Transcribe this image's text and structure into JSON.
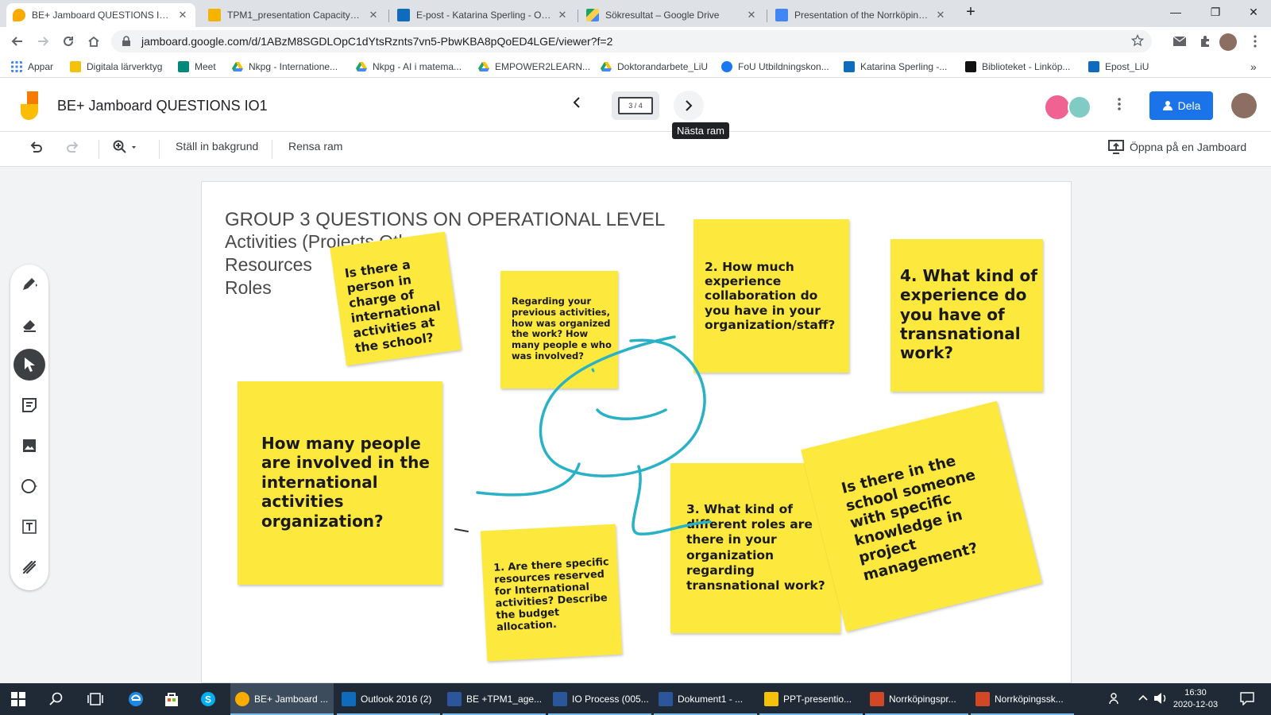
{
  "browser": {
    "tabs": [
      {
        "title": "BE+ Jamboard QUESTIONS IO1 -",
        "active": true,
        "favicon_color": "#f9ab00"
      },
      {
        "title": "TPM1_presentation Capacity Buil",
        "active": false,
        "favicon_color": "#f4b400"
      },
      {
        "title": "E-post - Katarina Sperling - Outlo",
        "active": false,
        "favicon_color": "#0f6cbd"
      },
      {
        "title": "Sökresultat – Google Drive",
        "active": false,
        "favicon_color": "#1fa463"
      },
      {
        "title": "Presentation of the Norrköping n",
        "active": false,
        "favicon_color": "#4285f4"
      }
    ],
    "close_glyph": "✕",
    "new_tab_glyph": "+",
    "window_controls": {
      "minimize": "—",
      "restore": "❐",
      "close": "✕"
    },
    "url": "jamboard.google.com/d/1ABzM8SGDLOpC1dYtsRznts7vn5-PbwKBA8pQoED4LGE/viewer?f=2",
    "bookmarks": [
      {
        "label": "Appar",
        "icon": "apps-grid-icon",
        "color": "#4285f4"
      },
      {
        "label": "Digitala lärverktyg",
        "icon": "folder-icon",
        "color": "#f4c20d"
      },
      {
        "label": "Meet",
        "icon": "meet-icon",
        "color": "#00897b"
      },
      {
        "label": "Nkpg - Internatione...",
        "icon": "drive-icon",
        "color": "#1fa463"
      },
      {
        "label": "Nkpg - AI i matema...",
        "icon": "drive-icon",
        "color": "#1fa463"
      },
      {
        "label": "EMPOWER2LEARN...",
        "icon": "drive-icon",
        "color": "#1fa463"
      },
      {
        "label": "Doktorandarbete_LiU",
        "icon": "drive-icon",
        "color": "#1fa463"
      },
      {
        "label": "FoU Utbildningskon...",
        "icon": "facebook-icon",
        "color": "#1877f2"
      },
      {
        "label": "Katarina Sperling -...",
        "icon": "outlook-icon",
        "color": "#0f6cbd"
      },
      {
        "label": "Biblioteket - Linköp...",
        "icon": "liu-icon",
        "color": "#111111"
      },
      {
        "label": "Epost_LiU",
        "icon": "outlook-icon",
        "color": "#0f6cbd"
      }
    ],
    "bookmarks_overflow": "»"
  },
  "jamboard": {
    "title": "BE+ Jamboard QUESTIONS IO1",
    "frame_indicator": "3 / 4",
    "tooltip": "Nästa ram",
    "share_label": "Dela",
    "toolbar": {
      "set_background": "Ställ in bakgrund",
      "clear_frame": "Rensa ram",
      "open_in_jamboard": "Öppna på en Jamboard"
    },
    "colors": {
      "sticky": "#fde93e",
      "ink": "#29b1c6",
      "share_button": "#1a73e8"
    }
  },
  "frame": {
    "heading": "GROUP 3 QUESTIONS ON OPERATIONAL LEVEL",
    "sub_lines": [
      "Activities (Projects Other)",
      "Resources",
      "Roles"
    ],
    "stickies": {
      "person_in_charge": "Is there a person in charge of international activities at the school?",
      "previous_activities": "Regarding your previous activities, how was organized the work? How many people e who was involved?",
      "experience_collaboration": "2. How much experience collaboration do you have in your organization/staff?",
      "transnational_experience": "4. What kind of experience do you have of transnational work?",
      "people_involved": "How many people are involved in the international activities organization?",
      "resources_reserved": "1. Are there specific resources reserved for International activities? Describe the budget allocation.",
      "roles": "3. What kind of different roles are there in your organization regarding transnational work?",
      "project_management": "Is there in the school someone with specific knowledge in project management?"
    }
  },
  "taskbar": {
    "items": [
      {
        "label": "BE+ Jamboard ...",
        "color": "#f9ab00",
        "active": true
      },
      {
        "label": "Outlook 2016 (2)",
        "color": "#0f6cbd",
        "active": false
      },
      {
        "label": "BE +TPM1_age...",
        "color": "#2b579a",
        "active": false
      },
      {
        "label": "IO Process (005...",
        "color": "#2b579a",
        "active": false
      },
      {
        "label": "Dokument1 - ...",
        "color": "#2b579a",
        "active": false
      },
      {
        "label": "PPT-presentio...",
        "color": "#f4c20d",
        "active": false
      },
      {
        "label": "Norrköpingspr...",
        "color": "#d24726",
        "active": false
      },
      {
        "label": "Norrköpingssk...",
        "color": "#d24726",
        "active": false
      }
    ],
    "time": "16:30",
    "date": "2020-12-03"
  }
}
